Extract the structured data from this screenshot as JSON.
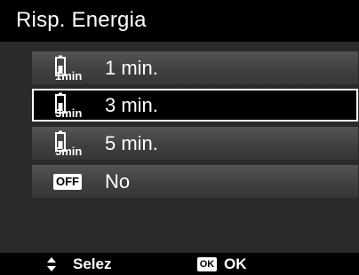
{
  "title": "Risp. Energia",
  "items": [
    {
      "label": "1 min.",
      "icon_text": "1min",
      "icon": "battery-timer-icon",
      "selected": false
    },
    {
      "label": "3 min.",
      "icon_text": "3min",
      "icon": "battery-timer-icon",
      "selected": true
    },
    {
      "label": "5 min.",
      "icon_text": "5min",
      "icon": "battery-timer-icon",
      "selected": false
    },
    {
      "label": "No",
      "icon_text": "OFF",
      "icon": "off-badge-icon",
      "selected": false
    }
  ],
  "footer": {
    "select_label": "Selez",
    "select_icon": "up-down-arrows-icon",
    "ok_badge": "OK",
    "ok_label": "OK"
  }
}
